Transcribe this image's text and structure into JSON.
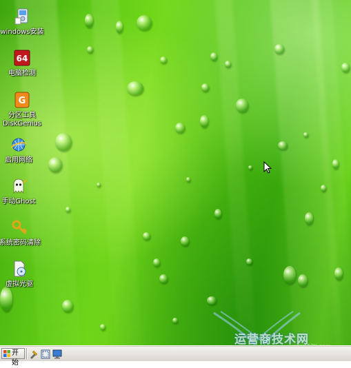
{
  "desktop": {
    "icons": [
      {
        "label": "windows安装",
        "icon": "windows-install-icon"
      },
      {
        "label": "电脑检测",
        "icon": "hardware-check-64-icon"
      },
      {
        "label": "分区工具",
        "label2": "DiskGenius",
        "icon": "diskgenius-icon"
      },
      {
        "label": "启用网络",
        "icon": "network-globe-icon"
      },
      {
        "label": "手动Ghost",
        "icon": "ghost-icon"
      },
      {
        "label": "系统密码清除",
        "icon": "key-icon"
      },
      {
        "label": "虚拟光驱",
        "icon": "virtual-drive-icon"
      }
    ],
    "hardware_check_badge": "64",
    "watermark": {
      "text": "运营商技术网",
      "url": "www.52lj.com"
    }
  },
  "taskbar": {
    "start_label": "开始",
    "quick_launch": [
      "tool-icon",
      "capture-icon",
      "monitor-icon"
    ]
  },
  "colors": {
    "wallpaper_primary": "#5cc814",
    "taskbar_bg": "#d9d7cf"
  }
}
